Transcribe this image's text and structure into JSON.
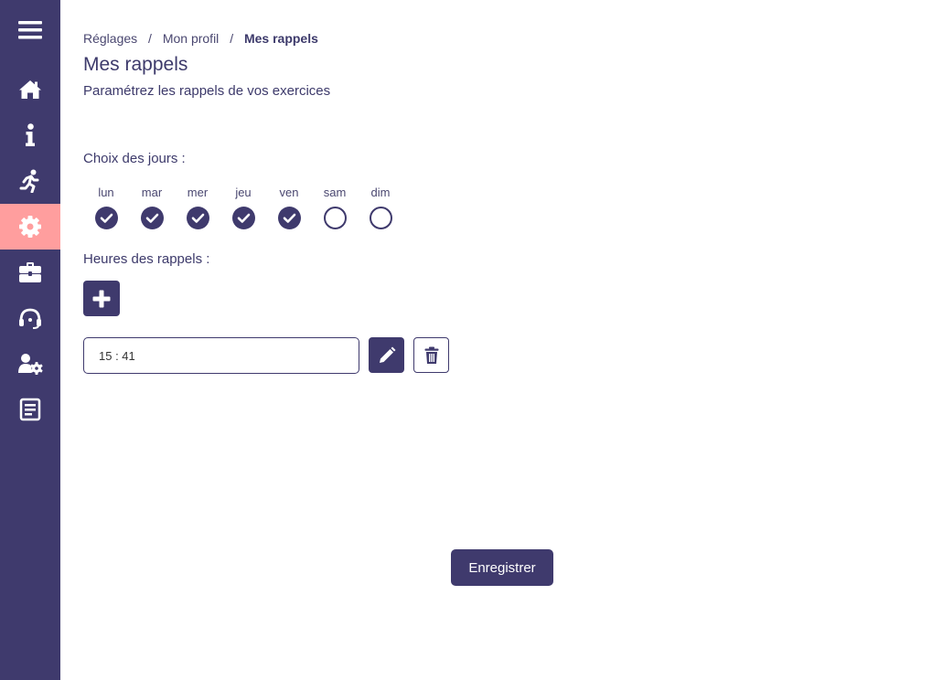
{
  "theme": {
    "primary": "#3f3a6d",
    "active_nav": "#ff9e9e",
    "background": "#ffffff"
  },
  "sidebar": {
    "items": [
      {
        "icon": "menu-icon",
        "active": false
      },
      {
        "icon": "home-icon",
        "active": false
      },
      {
        "icon": "info-icon",
        "active": false
      },
      {
        "icon": "running-icon",
        "active": false
      },
      {
        "icon": "gear-icon",
        "active": true
      },
      {
        "icon": "briefcase-icon",
        "active": false
      },
      {
        "icon": "headset-icon",
        "active": false
      },
      {
        "icon": "user-settings-icon",
        "active": false
      },
      {
        "icon": "document-icon",
        "active": false
      }
    ]
  },
  "breadcrumb": {
    "items": [
      "Réglages",
      "Mon profil",
      "Mes rappels"
    ],
    "separator": "/"
  },
  "page": {
    "title": "Mes rappels",
    "subtitle": "Paramétrez les rappels de vos exercices"
  },
  "days": {
    "label": "Choix des jours :",
    "items": [
      {
        "name": "lun",
        "checked": true
      },
      {
        "name": "mar",
        "checked": true
      },
      {
        "name": "mer",
        "checked": true
      },
      {
        "name": "jeu",
        "checked": true
      },
      {
        "name": "ven",
        "checked": true
      },
      {
        "name": "sam",
        "checked": false
      },
      {
        "name": "dim",
        "checked": false
      }
    ]
  },
  "hours": {
    "label": "Heures des rappels :",
    "add_icon": "plus-icon",
    "reminders": [
      {
        "time": "15 : 41",
        "edit_icon": "pencil-icon",
        "delete_icon": "trash-icon"
      }
    ]
  },
  "actions": {
    "save_label": "Enregistrer"
  }
}
